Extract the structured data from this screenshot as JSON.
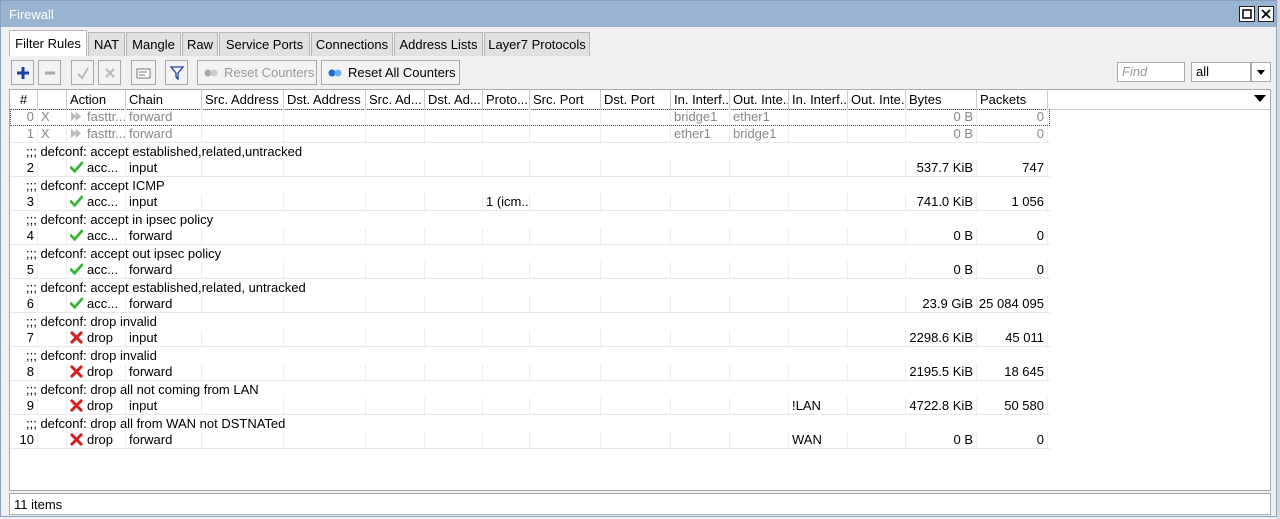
{
  "window": {
    "title": "Firewall"
  },
  "tabs": [
    "Filter Rules",
    "NAT",
    "Mangle",
    "Raw",
    "Service Ports",
    "Connections",
    "Address Lists",
    "Layer7 Protocols"
  ],
  "toolbar": {
    "reset_counters": "Reset Counters",
    "reset_all_counters": "Reset All Counters",
    "find_placeholder": "Find",
    "filter_value": "all",
    "icons": [
      "plus-icon",
      "minus-icon",
      "check-icon",
      "cross-icon",
      "comment-icon",
      "filter-icon"
    ]
  },
  "columns": [
    "#",
    "",
    "Action",
    "Chain",
    "Src. Address",
    "Dst. Address",
    "Src. Ad...",
    "Dst. Ad...",
    "Proto...",
    "Src. Port",
    "Dst. Port",
    "In. Interf...",
    "Out. Inte...",
    "In. Interf...",
    "Out. Inte...",
    "Bytes",
    "Packets"
  ],
  "rows": [
    {
      "type": "rule",
      "num": "0",
      "flag": "X",
      "action": "fasttr...",
      "action_icon": "fasttrack",
      "chain": "forward",
      "proto": "",
      "in_if": "bridge1",
      "out_if": "ether1",
      "in_if_list": "",
      "bytes": "0 B",
      "packets": "0",
      "disabled": true
    },
    {
      "type": "rule",
      "num": "1",
      "flag": "X",
      "action": "fasttr...",
      "action_icon": "fasttrack",
      "chain": "forward",
      "proto": "",
      "in_if": "ether1",
      "out_if": "bridge1",
      "in_if_list": "",
      "bytes": "0 B",
      "packets": "0",
      "disabled": true
    },
    {
      "type": "comment",
      "text": ";;; defconf: accept established,related,untracked"
    },
    {
      "type": "rule",
      "num": "2",
      "flag": "",
      "action": "acc...",
      "action_icon": "accept",
      "chain": "input",
      "proto": "",
      "in_if": "",
      "out_if": "",
      "in_if_list": "",
      "bytes": "537.7 KiB",
      "packets": "747",
      "disabled": false
    },
    {
      "type": "comment",
      "text": ";;; defconf: accept ICMP"
    },
    {
      "type": "rule",
      "num": "3",
      "flag": "",
      "action": "acc...",
      "action_icon": "accept",
      "chain": "input",
      "proto": "1 (icm...",
      "in_if": "",
      "out_if": "",
      "in_if_list": "",
      "bytes": "741.0 KiB",
      "packets": "1 056",
      "disabled": false
    },
    {
      "type": "comment",
      "text": ";;; defconf: accept in ipsec policy"
    },
    {
      "type": "rule",
      "num": "4",
      "flag": "",
      "action": "acc...",
      "action_icon": "accept",
      "chain": "forward",
      "proto": "",
      "in_if": "",
      "out_if": "",
      "in_if_list": "",
      "bytes": "0 B",
      "packets": "0",
      "disabled": false
    },
    {
      "type": "comment",
      "text": ";;; defconf: accept out ipsec policy"
    },
    {
      "type": "rule",
      "num": "5",
      "flag": "",
      "action": "acc...",
      "action_icon": "accept",
      "chain": "forward",
      "proto": "",
      "in_if": "",
      "out_if": "",
      "in_if_list": "",
      "bytes": "0 B",
      "packets": "0",
      "disabled": false
    },
    {
      "type": "comment",
      "text": ";;; defconf: accept established,related, untracked"
    },
    {
      "type": "rule",
      "num": "6",
      "flag": "",
      "action": "acc...",
      "action_icon": "accept",
      "chain": "forward",
      "proto": "",
      "in_if": "",
      "out_if": "",
      "in_if_list": "",
      "bytes": "23.9 GiB",
      "packets": "25 084 095",
      "disabled": false
    },
    {
      "type": "comment",
      "text": ";;; defconf: drop invalid"
    },
    {
      "type": "rule",
      "num": "7",
      "flag": "",
      "action": "drop",
      "action_icon": "drop",
      "chain": "input",
      "proto": "",
      "in_if": "",
      "out_if": "",
      "in_if_list": "",
      "bytes": "2298.6 KiB",
      "packets": "45 011",
      "disabled": false
    },
    {
      "type": "comment",
      "text": ";;; defconf: drop invalid"
    },
    {
      "type": "rule",
      "num": "8",
      "flag": "",
      "action": "drop",
      "action_icon": "drop",
      "chain": "forward",
      "proto": "",
      "in_if": "",
      "out_if": "",
      "in_if_list": "",
      "bytes": "2195.5 KiB",
      "packets": "18 645",
      "disabled": false
    },
    {
      "type": "comment",
      "text": ";;; defconf: drop all not coming from LAN"
    },
    {
      "type": "rule",
      "num": "9",
      "flag": "",
      "action": "drop",
      "action_icon": "drop",
      "chain": "input",
      "proto": "",
      "in_if": "",
      "out_if": "",
      "in_if_list": "!LAN",
      "bytes": "4722.8 KiB",
      "packets": "50 580",
      "disabled": false
    },
    {
      "type": "comment",
      "text": ";;; defconf:  drop all from WAN not DSTNATed"
    },
    {
      "type": "rule",
      "num": "10",
      "flag": "",
      "action": "drop",
      "action_icon": "drop",
      "chain": "forward",
      "proto": "",
      "in_if": "",
      "out_if": "",
      "in_if_list": "WAN",
      "bytes": "0 B",
      "packets": "0",
      "disabled": false
    }
  ],
  "status": {
    "items": "11 items"
  },
  "colors": {
    "titlebar": "#99b4d1",
    "accept": "#3ab53a",
    "drop": "#d42020",
    "plus": "#1a3fa8"
  }
}
